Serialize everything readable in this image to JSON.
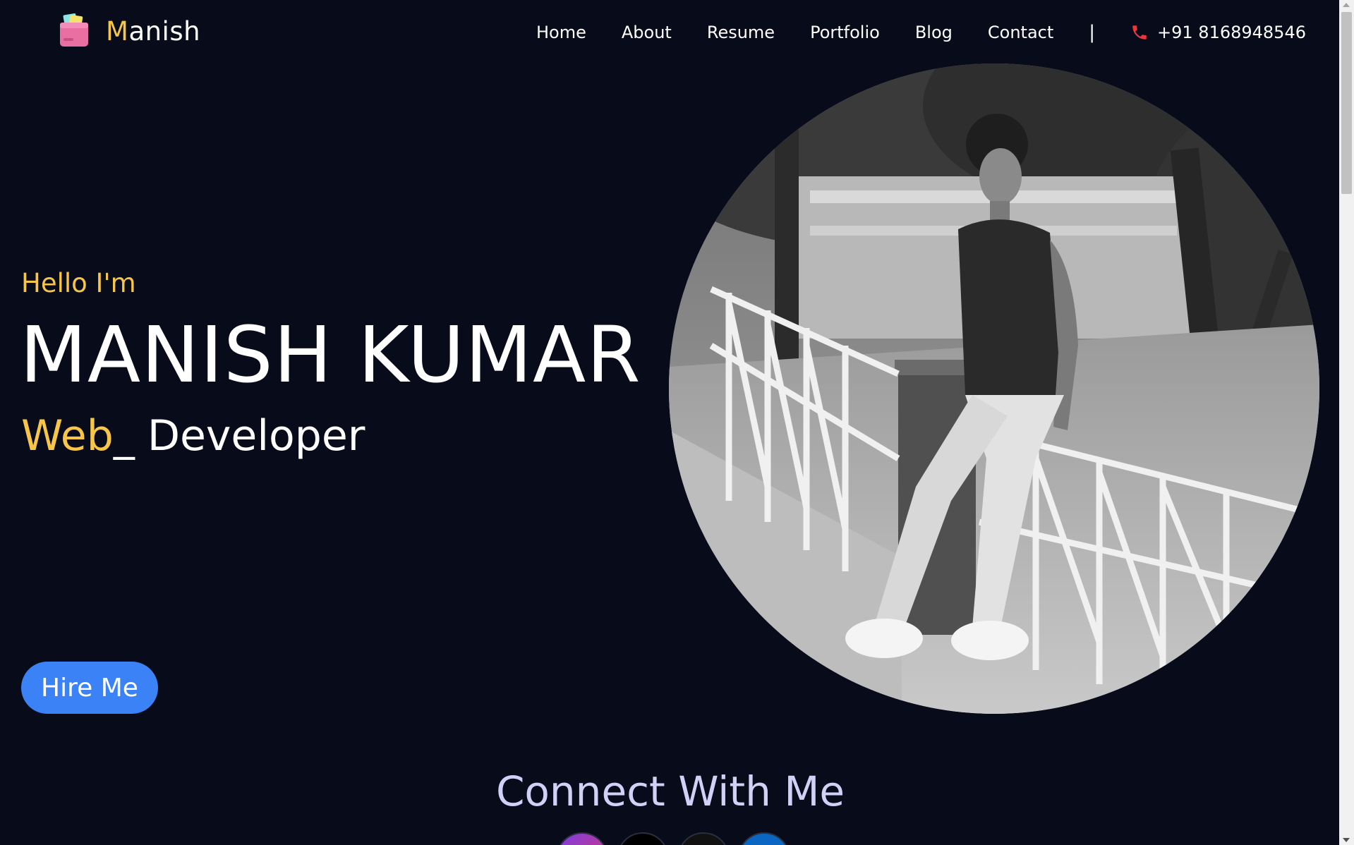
{
  "header": {
    "logo_text_first": "M",
    "logo_text_rest": "anish",
    "logo_icon": "folder-icon",
    "nav": [
      "Home",
      "About",
      "Resume",
      "Portfolio",
      "Blog",
      "Contact"
    ],
    "divider": "|",
    "phone_icon": "phone-icon",
    "phone": "+91 8168948546"
  },
  "hero": {
    "greeting": "Hello I'm",
    "name": "MANISH KUMAR",
    "role_typed": "Web",
    "role_cursor": "_",
    "role_rest": "Developer",
    "hire_button": "Hire Me",
    "photo": "profile-photo"
  },
  "connect": {
    "title": "Connect With Me",
    "socials": [
      "instagram-icon",
      "x-icon",
      "github-icon",
      "linkedin-icon"
    ]
  },
  "colors": {
    "background": "#070b1a",
    "accent": "#f7c548",
    "button": "#3b82f6",
    "connect_title": "#d2d0f7",
    "phone_icon": "#e8383d"
  }
}
